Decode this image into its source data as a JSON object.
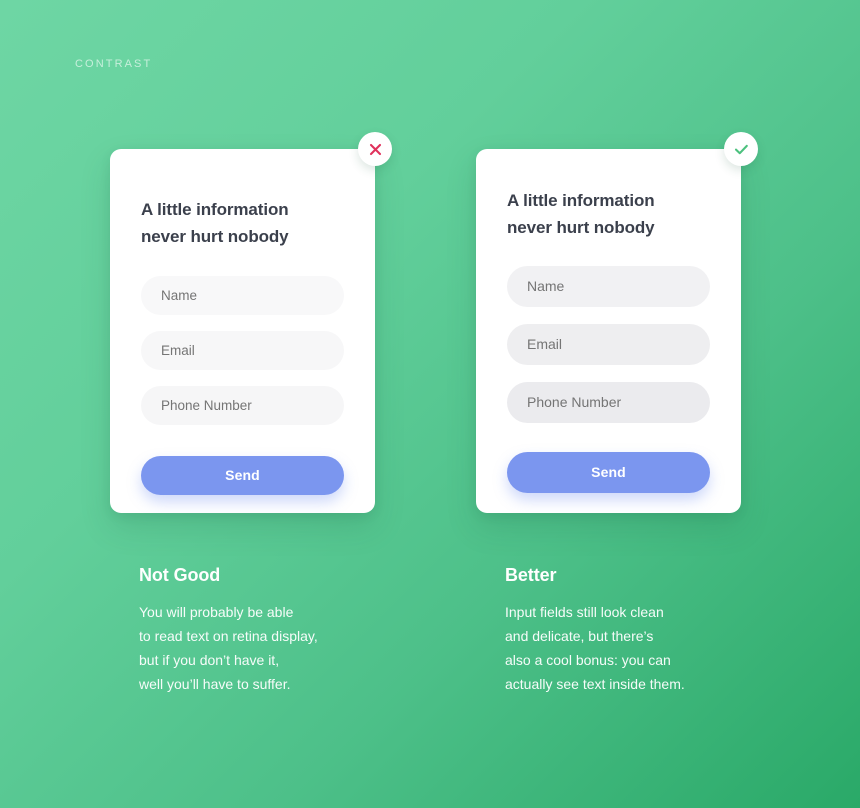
{
  "page": {
    "eyebrow": "CONTRAST",
    "background_from": "#6ed6a4",
    "background_to": "#2aa968"
  },
  "cards": [
    {
      "id": "not-good",
      "badge_icon": "close-icon",
      "badge_color": "#e0315b",
      "title": "A little information\nnever hurt nobody",
      "title_color": "#3b404c",
      "fields": [
        {
          "name": "name",
          "placeholder": "Name",
          "value": "",
          "bg": "#f8f8f9",
          "placeholder_color": "#ebebed"
        },
        {
          "name": "email",
          "placeholder": "Email",
          "value": "",
          "bg": "#f7f7f8",
          "placeholder_color": "#e7e7ea"
        },
        {
          "name": "phone",
          "placeholder": "Phone Number",
          "value": "",
          "bg": "#f6f6f7",
          "placeholder_color": "#e3e3e6"
        }
      ],
      "send_label": "Send",
      "send_color": "#7b96ef",
      "caption_title": "Not Good",
      "caption_body": "You will probably be able\nto read text on retina display,\nbut if you don’t have it,\nwell you’ll have to suffer."
    },
    {
      "id": "better",
      "badge_icon": "check-icon",
      "badge_color": "#4cc17e",
      "title": "A little information\nnever hurt nobody",
      "title_color": "#3b404c",
      "fields": [
        {
          "name": "name",
          "placeholder": "Name",
          "value": "",
          "bg": "#f1f1f3",
          "placeholder_color": "#b9babf"
        },
        {
          "name": "email",
          "placeholder": "Email",
          "value": "",
          "bg": "#eeeef0",
          "placeholder_color": "#b2b3b9"
        },
        {
          "name": "phone",
          "placeholder": "Phone Number",
          "value": "",
          "bg": "#ebebee",
          "placeholder_color": "#aaabb1"
        }
      ],
      "send_label": "Send",
      "send_color": "#7b96ef",
      "caption_title": "Better",
      "caption_body": "Input fields still look clean\nand delicate, but there’s\nalso a cool bonus: you can\nactually see text inside them."
    }
  ]
}
